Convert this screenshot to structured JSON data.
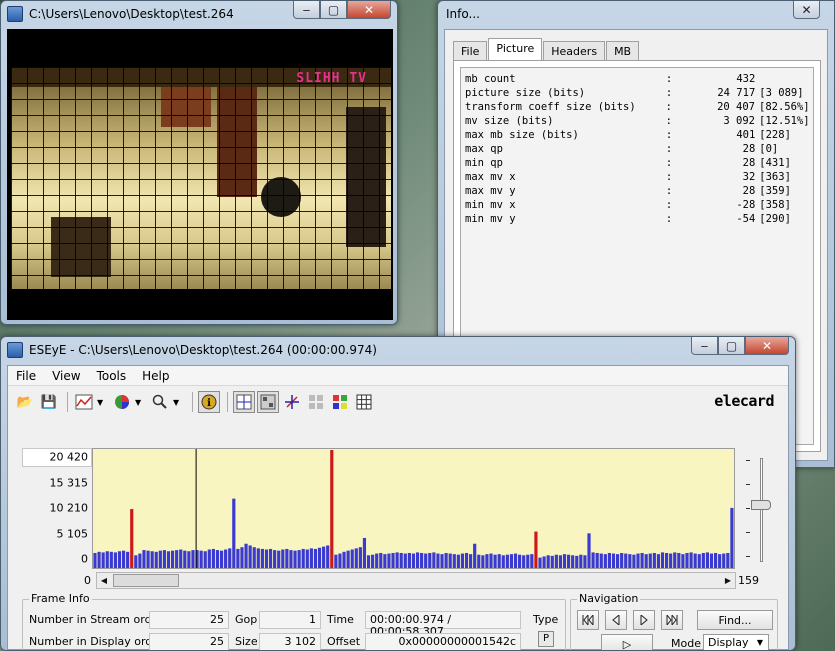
{
  "video_window": {
    "title": "C:\\Users\\Lenovo\\Desktop\\test.264",
    "logo_text": "SLIHH TV"
  },
  "info_window": {
    "title": "Info...",
    "tabs": [
      "File",
      "Picture",
      "Headers",
      "MB"
    ],
    "active_tab": "Picture",
    "rows": [
      {
        "key": "mb count",
        "value": "432",
        "extra": ""
      },
      {
        "key": "picture size (bits)",
        "value": "24 717",
        "extra": "[3 089]"
      },
      {
        "key": "transform coeff size (bits)",
        "value": "20 407",
        "extra": "[82.56%]"
      },
      {
        "key": "mv size (bits)",
        "value": "3 092",
        "extra": "[12.51%]"
      },
      {
        "key": "max mb size (bits)",
        "value": "401",
        "extra": "[228]"
      },
      {
        "key": "max qp",
        "value": "28",
        "extra": "[0]"
      },
      {
        "key": "min qp",
        "value": "28",
        "extra": "[431]"
      },
      {
        "key": "max mv x",
        "value": "32",
        "extra": "[363]"
      },
      {
        "key": "max mv y",
        "value": "28",
        "extra": "[359]"
      },
      {
        "key": "min mv x",
        "value": "-28",
        "extra": "[358]"
      },
      {
        "key": "min mv y",
        "value": "-54",
        "extra": "[290]"
      }
    ]
  },
  "eseye_window": {
    "title": "ESEyE - C:\\Users\\Lenovo\\Desktop\\test.264 (00:00:00.974)",
    "menu": [
      "File",
      "View",
      "Tools",
      "Help"
    ],
    "brand": "elecard",
    "icons": {
      "open": "folder-open-icon",
      "save": "save-icon",
      "graph": "graph-icon",
      "color": "color-wheel-icon",
      "zoom": "magnifier-icon",
      "info": "info-icon"
    }
  },
  "chart_data": {
    "type": "bar",
    "y_ticks": [
      "20 420",
      "15 315",
      "10 210",
      "5 105",
      "0"
    ],
    "ylim": [
      0,
      20420
    ],
    "x_range": [
      0,
      159
    ],
    "cursor_frame": 25,
    "colors": {
      "p_frame": "#3a3ad0",
      "i_frame": "#cc1a1a",
      "background": "#f8f5c0"
    },
    "i_frames": [
      {
        "frame": 9,
        "value": 10200
      },
      {
        "frame": 58,
        "value": 20420
      },
      {
        "frame": 108,
        "value": 6300
      },
      {
        "frame": 158,
        "value": 10400
      }
    ],
    "p_frame_values": [
      2600,
      2800,
      2700,
      2900,
      2800,
      2700,
      2900,
      3000,
      2800,
      10200,
      2200,
      2500,
      3100,
      3000,
      2900,
      2800,
      3000,
      3100,
      2900,
      3000,
      3100,
      3200,
      3000,
      2900,
      3100,
      3102,
      3000,
      2900,
      3200,
      3300,
      3100,
      3000,
      3200,
      3400,
      12000,
      3300,
      3600,
      4200,
      3900,
      3600,
      3400,
      3300,
      3200,
      3300,
      3100,
      3000,
      3200,
      3300,
      3100,
      3000,
      3100,
      3300,
      3200,
      3400,
      3300,
      3500,
      3700,
      3900,
      20420,
      2300,
      2500,
      2800,
      3000,
      3200,
      3400,
      3600,
      5200,
      2200,
      2300,
      2500,
      2600,
      2400,
      2500,
      2600,
      2700,
      2600,
      2500,
      2600,
      2500,
      2700,
      2600,
      2500,
      2600,
      2700,
      2500,
      2400,
      2600,
      2500,
      2400,
      2300,
      2500,
      2600,
      2400,
      4200,
      2300,
      2200,
      2400,
      2500,
      2300,
      2400,
      2200,
      2300,
      2400,
      2500,
      2300,
      2200,
      2300,
      2400,
      6300,
      1800,
      2000,
      2200,
      2100,
      2300,
      2200,
      2400,
      2300,
      2200,
      2100,
      2300,
      2200,
      6000,
      2700,
      2600,
      2500,
      2400,
      2600,
      2500,
      2400,
      2600,
      2500,
      2400,
      2300,
      2500,
      2600,
      2400,
      2500,
      2600,
      2400,
      2700,
      2600,
      2500,
      2700,
      2600,
      2400,
      2600,
      2700,
      2500,
      2400,
      2600,
      2700,
      2500,
      2600,
      2400,
      2500,
      2600,
      10400
    ]
  },
  "scroll": {
    "min": "0",
    "max": "159"
  },
  "frame_info": {
    "legend": "Frame Info",
    "stream_order_label": "Number in Stream order",
    "stream_order": "25",
    "display_order_label": "Number in Display order",
    "display_order": "25",
    "gop_label": "Gop",
    "gop": "1",
    "size_label": "Size",
    "size": "3 102",
    "time_label": "Time",
    "time": "00:00:00.974 / 00:00:58.307",
    "offset_label": "Offset",
    "offset": "0x00000000001542c",
    "type_label": "Type",
    "type": "P"
  },
  "navigation": {
    "legend": "Navigation",
    "find_label": "Find...",
    "play_symbol": "▷",
    "mode_label": "Mode",
    "mode_value": "Display"
  }
}
